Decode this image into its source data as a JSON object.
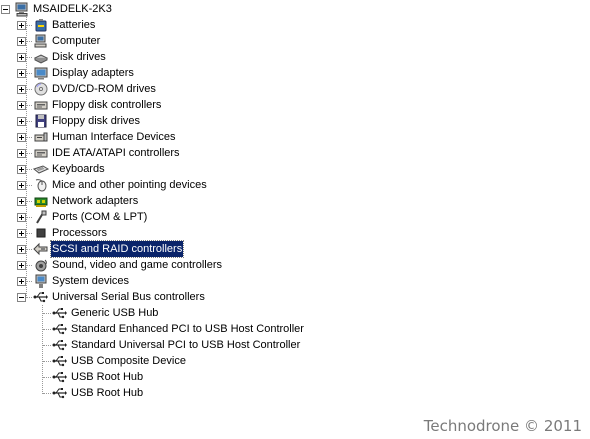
{
  "root": {
    "label": "MSAIDELK-2K3",
    "icon": "computer-icon"
  },
  "categories": [
    {
      "label": "Batteries",
      "icon": "battery-icon"
    },
    {
      "label": "Computer",
      "icon": "computer-icon"
    },
    {
      "label": "Disk drives",
      "icon": "disk-drive-icon"
    },
    {
      "label": "Display adapters",
      "icon": "display-adapter-icon"
    },
    {
      "label": "DVD/CD-ROM drives",
      "icon": "cdrom-icon"
    },
    {
      "label": "Floppy disk controllers",
      "icon": "controller-icon"
    },
    {
      "label": "Floppy disk drives",
      "icon": "floppy-icon"
    },
    {
      "label": "Human Interface Devices",
      "icon": "hid-icon"
    },
    {
      "label": "IDE ATA/ATAPI controllers",
      "icon": "controller-icon"
    },
    {
      "label": "Keyboards",
      "icon": "keyboard-icon"
    },
    {
      "label": "Mice and other pointing devices",
      "icon": "mouse-icon"
    },
    {
      "label": "Network adapters",
      "icon": "network-adapter-icon"
    },
    {
      "label": "Ports (COM & LPT)",
      "icon": "port-icon"
    },
    {
      "label": "Processors",
      "icon": "processor-icon"
    },
    {
      "label": "SCSI and RAID controllers",
      "icon": "scsi-icon",
      "selected": true
    },
    {
      "label": "Sound, video and game controllers",
      "icon": "sound-icon"
    },
    {
      "label": "System devices",
      "icon": "system-device-icon"
    },
    {
      "label": "Universal Serial Bus controllers",
      "icon": "usb-icon",
      "expanded": true
    }
  ],
  "usb_children": [
    {
      "label": "Generic USB Hub",
      "icon": "usb-icon"
    },
    {
      "label": "Standard Enhanced PCI to USB Host Controller",
      "icon": "usb-icon"
    },
    {
      "label": "Standard Universal PCI to USB Host Controller",
      "icon": "usb-icon"
    },
    {
      "label": "USB Composite Device",
      "icon": "usb-icon"
    },
    {
      "label": "USB Root Hub",
      "icon": "usb-icon"
    },
    {
      "label": "USB Root Hub",
      "icon": "usb-icon"
    }
  ],
  "watermark": "Technodrone © 2011",
  "colors": {
    "selection_bg": "#0a246a",
    "selection_text": "#ffffff",
    "connector": "#9a9a9a",
    "watermark": "#7a7a7a"
  }
}
